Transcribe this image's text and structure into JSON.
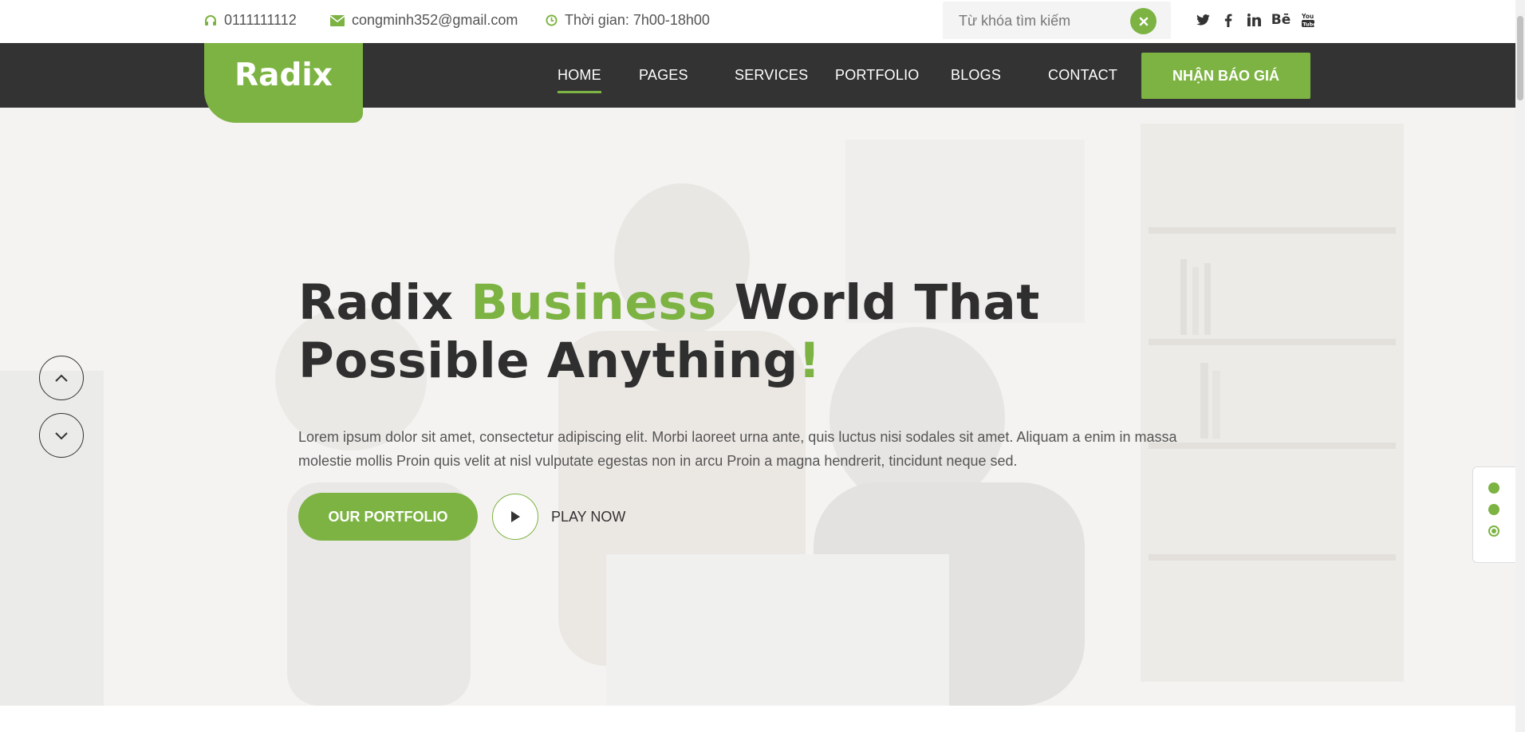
{
  "topbar": {
    "phone": "0111111112",
    "email": "congminh352@gmail.com",
    "hours": "Thời gian: 7h00-18h00",
    "search_placeholder": "Từ khóa tìm kiếm",
    "socials": [
      "twitter-icon",
      "facebook-icon",
      "linkedin-icon",
      "behance-icon",
      "youtube-icon"
    ]
  },
  "brand": {
    "logo_text": "Radix",
    "accent_color": "#7cb342",
    "nav_bg": "#333333"
  },
  "nav": {
    "items": [
      {
        "label": "HOME"
      },
      {
        "label": "PAGES"
      },
      {
        "label": "SERVICES"
      },
      {
        "label": "PORTFOLIO"
      },
      {
        "label": "BLOGS"
      },
      {
        "label": "CONTACT"
      }
    ],
    "active_item": "HOME",
    "cta_label": "NHẬN BÁO GIÁ"
  },
  "hero": {
    "title_part1": "Radix ",
    "title_accent": "Business",
    "title_part2": " World That Possible Anything",
    "title_end": "!",
    "description": "Lorem ipsum dolor sit amet, consectetur adipiscing elit. Morbi laoreet urna ante, quis luctus nisi sodales sit amet. Aliquam a enim in massa molestie mollis Proin quis velit at nisl vulputate egestas non in arcu Proin a magna hendrerit, tincidunt neque sed.",
    "portfolio_label": "OUR PORTFOLIO",
    "play_label": "PLAY NOW",
    "active_slide": 3,
    "slide_count": 3
  }
}
